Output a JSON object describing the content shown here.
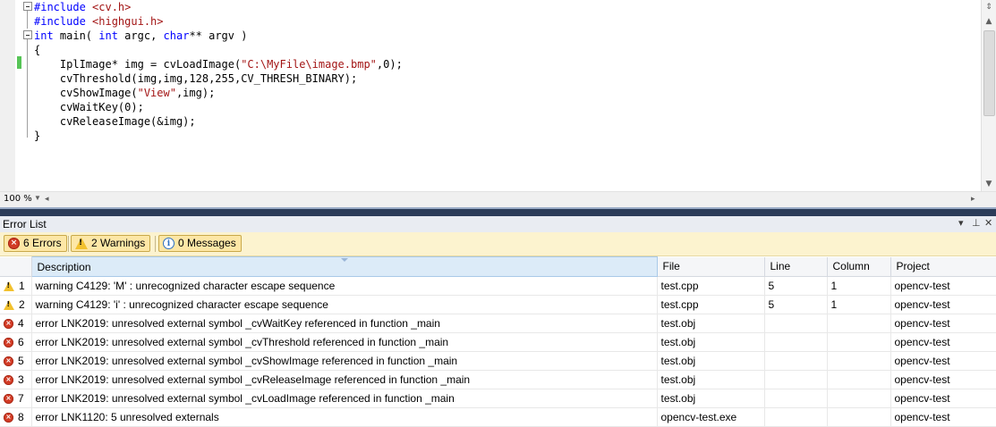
{
  "editor": {
    "code_lines": [
      {
        "parts": [
          {
            "t": "#include ",
            "c": "pp"
          },
          {
            "t": "<cv.h>",
            "c": "str"
          }
        ]
      },
      {
        "parts": [
          {
            "t": "#include ",
            "c": "pp"
          },
          {
            "t": "<highgui.h>",
            "c": "str"
          }
        ]
      },
      {
        "parts": [
          {
            "t": "int",
            "c": "kw"
          },
          {
            "t": " main( ",
            "c": ""
          },
          {
            "t": "int",
            "c": "kw"
          },
          {
            "t": " argc, ",
            "c": ""
          },
          {
            "t": "char",
            "c": "kw"
          },
          {
            "t": "** argv )",
            "c": ""
          }
        ]
      },
      {
        "parts": [
          {
            "t": "{",
            "c": ""
          }
        ]
      },
      {
        "parts": [
          {
            "t": "    IplImage* img = cvLoadImage(",
            "c": ""
          },
          {
            "t": "\"C:\\MyFile\\image.bmp\"",
            "c": "str"
          },
          {
            "t": ",0);",
            "c": ""
          }
        ]
      },
      {
        "parts": [
          {
            "t": "    cvThreshold(img,img,128,255,CV_THRESH_BINARY);",
            "c": ""
          }
        ]
      },
      {
        "parts": [
          {
            "t": "    cvShowImage(",
            "c": ""
          },
          {
            "t": "\"View\"",
            "c": "str"
          },
          {
            "t": ",img);",
            "c": ""
          }
        ]
      },
      {
        "parts": [
          {
            "t": "    cvWaitKey(0);",
            "c": ""
          }
        ]
      },
      {
        "parts": [
          {
            "t": "    cvReleaseImage(&img);",
            "c": ""
          }
        ]
      },
      {
        "parts": [
          {
            "t": "}",
            "c": ""
          }
        ]
      }
    ],
    "zoom": "100 %"
  },
  "error_list": {
    "title": "Error List",
    "filters": {
      "errors": "6 Errors",
      "warnings": "2 Warnings",
      "messages": "0 Messages"
    },
    "columns": {
      "description": "Description",
      "file": "File",
      "line": "Line",
      "column": "Column",
      "project": "Project"
    },
    "rows": [
      {
        "type": "warning",
        "order": "1",
        "description": "warning C4129: 'M' : unrecognized character escape sequence",
        "file": "test.cpp",
        "line": "5",
        "column": "1",
        "project": "opencv-test"
      },
      {
        "type": "warning",
        "order": "2",
        "description": "warning C4129: 'i' : unrecognized character escape sequence",
        "file": "test.cpp",
        "line": "5",
        "column": "1",
        "project": "opencv-test"
      },
      {
        "type": "error",
        "order": "4",
        "description": "error LNK2019: unresolved external symbol _cvWaitKey referenced in function _main",
        "file": "test.obj",
        "line": "",
        "column": "",
        "project": "opencv-test"
      },
      {
        "type": "error",
        "order": "6",
        "description": "error LNK2019: unresolved external symbol _cvThreshold referenced in function _main",
        "file": "test.obj",
        "line": "",
        "column": "",
        "project": "opencv-test"
      },
      {
        "type": "error",
        "order": "5",
        "description": "error LNK2019: unresolved external symbol _cvShowImage referenced in function _main",
        "file": "test.obj",
        "line": "",
        "column": "",
        "project": "opencv-test"
      },
      {
        "type": "error",
        "order": "3",
        "description": "error LNK2019: unresolved external symbol _cvReleaseImage referenced in function _main",
        "file": "test.obj",
        "line": "",
        "column": "",
        "project": "opencv-test"
      },
      {
        "type": "error",
        "order": "7",
        "description": "error LNK2019: unresolved external symbol _cvLoadImage referenced in function _main",
        "file": "test.obj",
        "line": "",
        "column": "",
        "project": "opencv-test"
      },
      {
        "type": "error",
        "order": "8",
        "description": "error LNK1120: 5 unresolved externals",
        "file": "opencv-test.exe",
        "line": "",
        "column": "",
        "project": "opencv-test"
      }
    ]
  },
  "icons": {
    "error": "error-icon",
    "warning": "warning-icon",
    "info": "info-icon"
  },
  "colors": {
    "keyword": "#0000ff",
    "string": "#a31515",
    "splitter": "#2b3c59",
    "filter_bar": "#fcf3cf"
  }
}
